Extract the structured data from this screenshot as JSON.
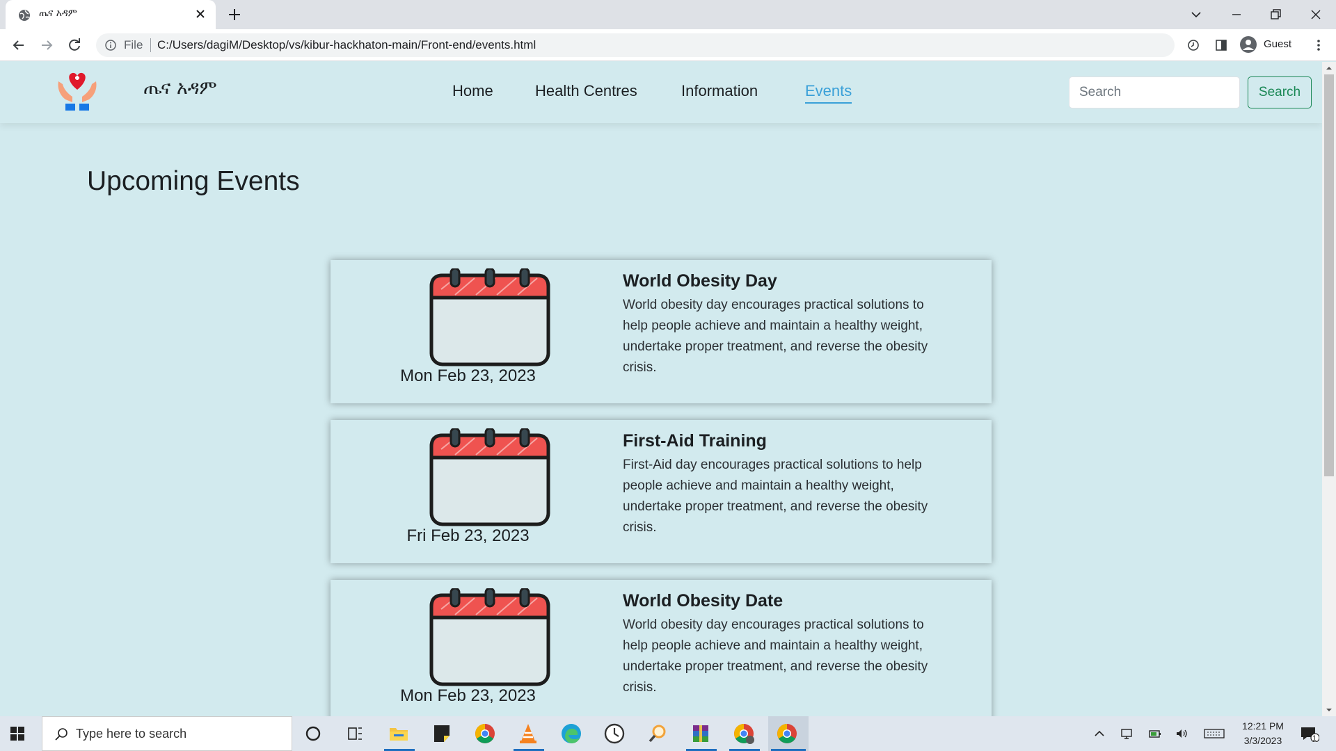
{
  "browser": {
    "tab_title": "ጤና አዳም",
    "url_scheme": "File",
    "url": "C:/Users/dagiM/Desktop/vs/kibur-hackhaton-main/Front-end/events.html",
    "profile_label": "Guest"
  },
  "site": {
    "brand": "ጤና አዳም",
    "nav": [
      {
        "label": "Home"
      },
      {
        "label": "Health Centres"
      },
      {
        "label": "Information"
      },
      {
        "label": "Events",
        "active": true
      }
    ],
    "search": {
      "placeholder": "Search",
      "button_label": "Search"
    }
  },
  "page": {
    "title": "Upcoming Events",
    "events": [
      {
        "date": "Mon Feb 23, 2023",
        "title": "World Obesity Day",
        "description": "World obesity day encourages practical solutions to help people achieve and maintain a healthy weight, undertake proper treatment, and reverse the obesity crisis."
      },
      {
        "date": "Fri Feb 23, 2023",
        "title": "First-Aid Training",
        "description": "First-Aid day encourages practical solutions to help people achieve and maintain a healthy weight, undertake proper treatment, and reverse the obesity crisis."
      },
      {
        "date": "Mon Feb 23, 2023",
        "title": "World Obesity Date",
        "description": "World obesity day encourages practical solutions to help people achieve and maintain a healthy weight, undertake proper treatment, and reverse the obesity crisis."
      }
    ]
  },
  "taskbar": {
    "search_placeholder": "Type here to search",
    "time": "12:21 PM",
    "date": "3/3/2023",
    "notification_count": "1"
  },
  "colors": {
    "page_bg": "#d2eaee",
    "nav_active": "#3aa0d8",
    "search_button": "#198754",
    "calendar_red": "#ef5350"
  }
}
